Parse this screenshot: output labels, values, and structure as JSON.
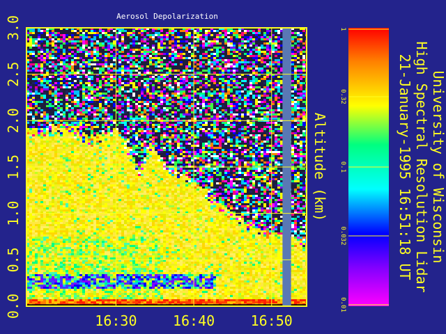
{
  "chart_data": {
    "type": "heatmap",
    "title": "Aerosol Depolarization",
    "ylabel": "Altitude (km)",
    "xlabel": "",
    "ylim": [
      0.0,
      3.0
    ],
    "y_ticks": [
      "0.0",
      "0.5",
      "1.0",
      "1.5",
      "2.0",
      "2.5",
      "3.0"
    ],
    "x_ticks": [
      "16:30",
      "16:40",
      "16:50"
    ],
    "x_tick_minutes": [
      990,
      1000,
      1010
    ],
    "xlim_minutes": [
      978.5,
      1014.5
    ],
    "grid": true,
    "colorbar": {
      "scale": "log",
      "range": [
        0.01,
        1
      ],
      "tick_labels": [
        "1",
        "0.32",
        "0.1",
        "0.032",
        "0.01"
      ],
      "colors": [
        "#ff00ff",
        "#8000ff",
        "#0000ff",
        "#00ffff",
        "#00ff80",
        "#ffff00",
        "#ff8000",
        "#ff0000"
      ]
    },
    "data_gap": {
      "start_minute": 1011.4,
      "end_minute": 1012.5,
      "color": "#5a78b4"
    },
    "layer_top_km": [
      {
        "minute": 978.5,
        "km": 1.9
      },
      {
        "minute": 984,
        "km": 1.92
      },
      {
        "minute": 987,
        "km": 1.8
      },
      {
        "minute": 990,
        "km": 1.9
      },
      {
        "minute": 991.5,
        "km": 1.7
      },
      {
        "minute": 993,
        "km": 1.45
      },
      {
        "minute": 994.5,
        "km": 1.75
      },
      {
        "minute": 996,
        "km": 1.55
      },
      {
        "minute": 1000,
        "km": 1.35
      },
      {
        "minute": 1004,
        "km": 1.05
      },
      {
        "minute": 1008,
        "km": 0.85
      },
      {
        "minute": 1011,
        "km": 0.75
      },
      {
        "minute": 1014.5,
        "km": 0.7
      }
    ]
  },
  "sidebar": {
    "line1": "University of Wisconsin",
    "line2": "High Spectral Resolution Lidar",
    "line3": "21-January-1995 16:51:18 UT"
  },
  "colors": {
    "background": "#23238c",
    "axis": "#ffff22",
    "grid": "#ffff22",
    "title": "#ffffff"
  }
}
